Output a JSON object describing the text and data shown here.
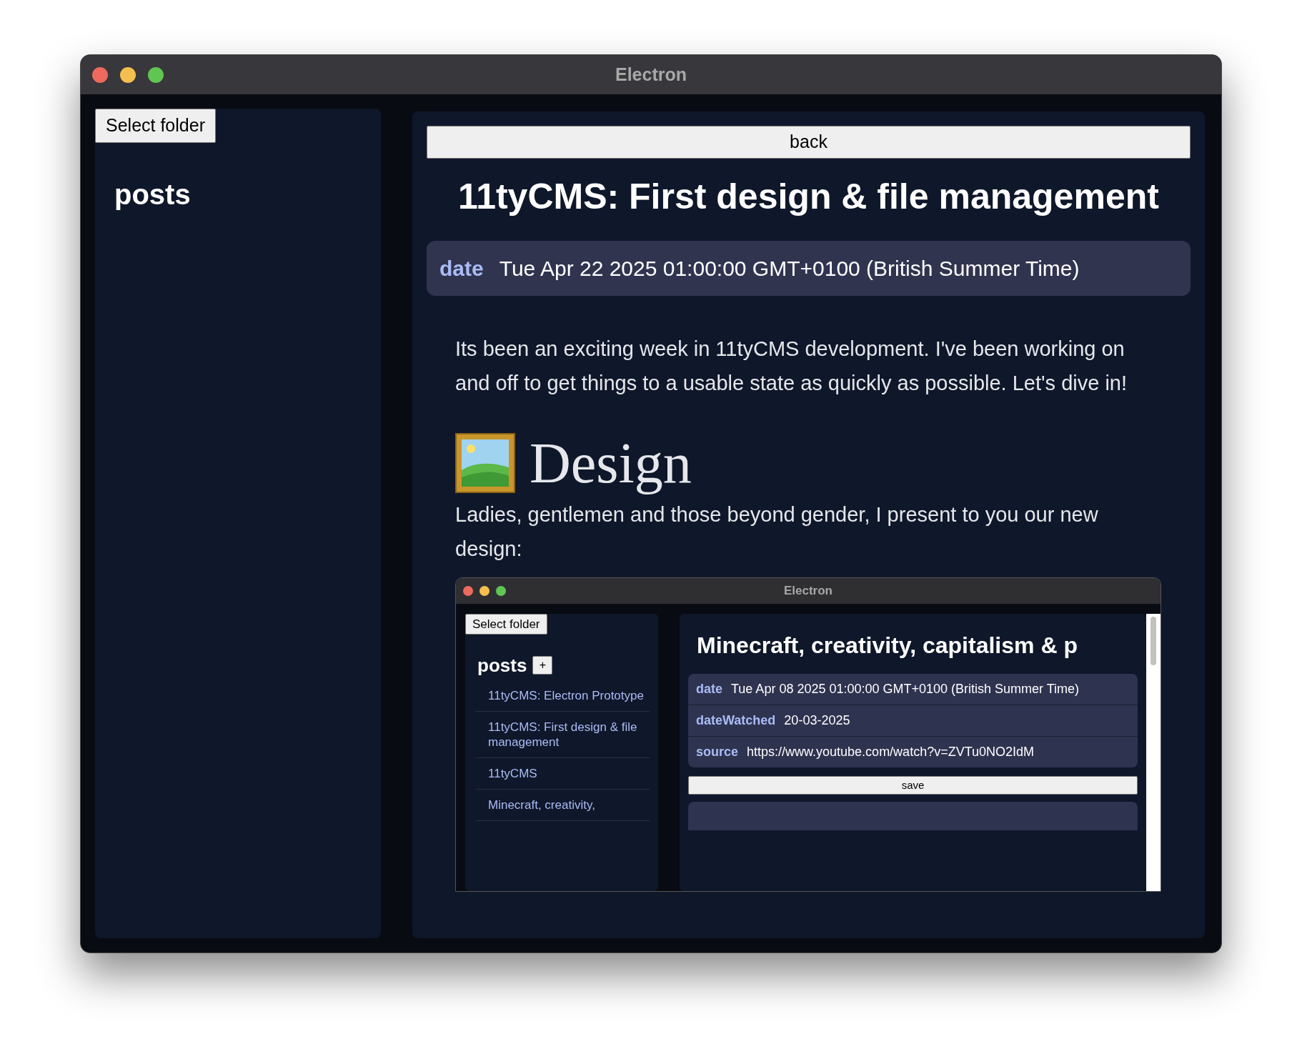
{
  "window": {
    "title": "Electron"
  },
  "sidebar": {
    "button": "Select folder",
    "heading": "posts"
  },
  "main": {
    "back_button": "back",
    "title": "11tyCMS: First design & file management",
    "fields": [
      {
        "key": "date",
        "value": "Tue Apr 22 2025 01:00:00 GMT+0100 (British Summer Time)"
      }
    ],
    "body": [
      {
        "kind": "paragraph",
        "text": "Its been an exciting week in 11tyCMS development. I've been working on and off to get things to a usable state as quickly as possible. Let's dive in!"
      },
      {
        "kind": "heading",
        "text": "Design"
      },
      {
        "kind": "paragraph",
        "text": "Ladies, gentlemen and those beyond gender, I present to you our new design:"
      },
      {
        "kind": "screenshot",
        "window": {
          "title": "Electron"
        },
        "sidebar": {
          "button": "Select folder",
          "heading": "posts",
          "add_button": "+",
          "items": [
            "11tyCMS: Electron Prototype",
            "11tyCMS: First design & file management",
            "11tyCMS",
            "Minecraft, creativity,"
          ]
        },
        "main": {
          "title": "Minecraft, creativity, capitalism & p",
          "fields": [
            {
              "key": "date",
              "value": "Tue Apr 08 2025 01:00:00 GMT+0100 (British Summer Time)"
            },
            {
              "key": "dateWatched",
              "value": "20-03-2025"
            },
            {
              "key": "source",
              "value": "https://www.youtube.com/watch?v=ZVTu0NO2IdM"
            }
          ],
          "save_button": "save"
        }
      }
    ]
  }
}
